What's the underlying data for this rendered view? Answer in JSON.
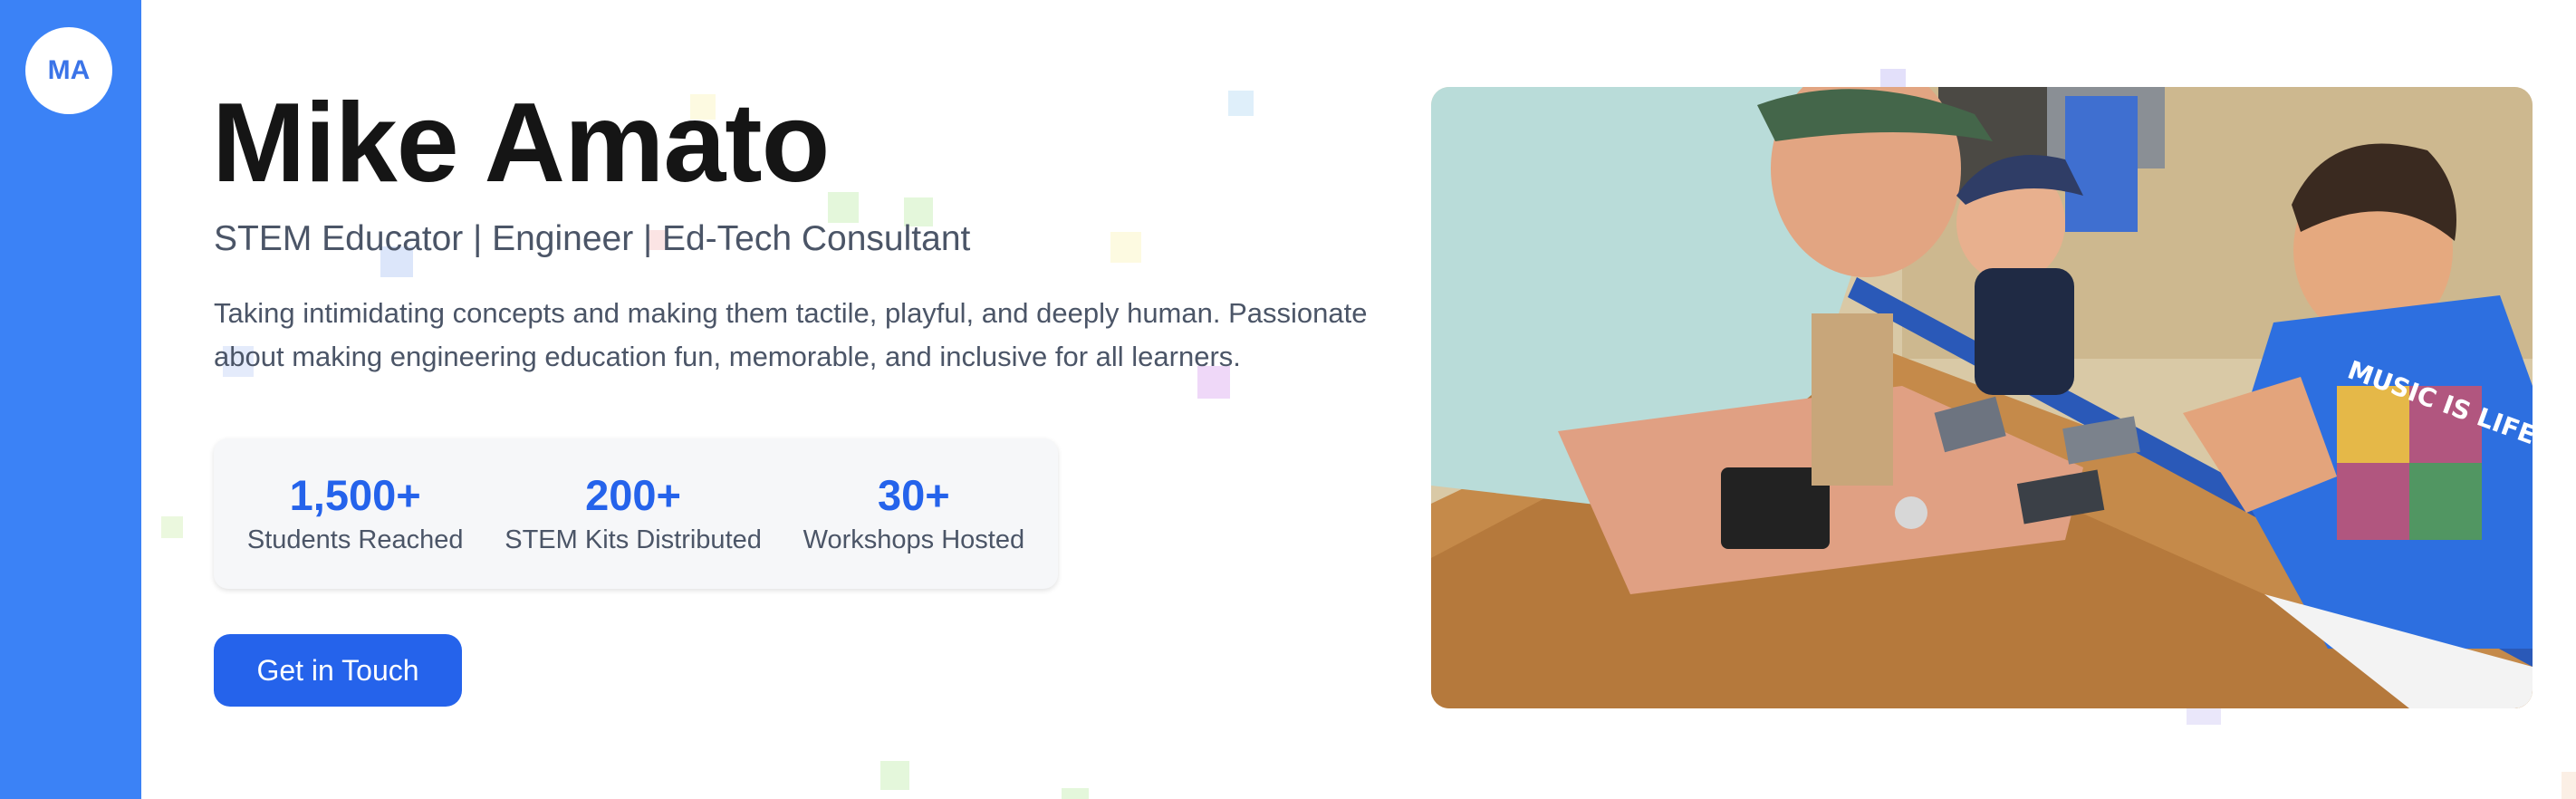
{
  "sidebar": {
    "avatar_initials": "MA",
    "color": "#3b82f6"
  },
  "hero": {
    "name": "Mike Amato",
    "tagline": "STEM Educator | Engineer | Ed-Tech Consultant",
    "bio": "Taking intimidating concepts and making them tactile, playful, and deeply human. Passionate about making engineering education fun, memorable, and inclusive for all learners."
  },
  "stats": [
    {
      "value": "1,500+",
      "label": "Students Reached"
    },
    {
      "value": "200+",
      "label": "STEM Kits Distributed"
    },
    {
      "value": "30+",
      "label": "Workshops Hosted"
    }
  ],
  "cta": {
    "label": "Get in Touch"
  },
  "photo": {
    "subject": "educator-with-children-photo",
    "shirt_text": "MUSIC IS LIFE"
  },
  "colors": {
    "accent": "#2563eb",
    "heading": "#151515",
    "body_text": "#4b5567"
  }
}
